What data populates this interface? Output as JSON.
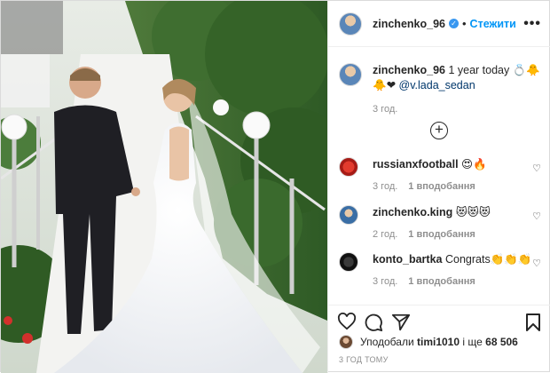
{
  "header": {
    "username": "zinchenko_96",
    "separator": "•",
    "follow_label": "Стежити",
    "more_icon": "more-horizontal-icon"
  },
  "caption": {
    "username": "zinchenko_96",
    "text": "1 year today 💍🐥",
    "text2": "🐥❤",
    "mention": "@v.lada_sedan",
    "time": "3 год."
  },
  "load_more_icon": "plus-circle-icon",
  "comments": [
    {
      "username": "russianxfootball",
      "text": "😍🔥",
      "time": "3 год.",
      "likes": "1 вподобання"
    },
    {
      "username": "zinchenko.king",
      "text": "😻😻😻",
      "time": "2 год.",
      "likes": "1 вподобання"
    },
    {
      "username": "konto_bartka",
      "text": "Congrats👏👏👏",
      "time": "3 год.",
      "likes": "1 вподобання"
    }
  ],
  "actions": {
    "like_icon": "heart-outline-icon",
    "comment_icon": "comment-icon",
    "share_icon": "paper-plane-icon",
    "save_icon": "bookmark-icon"
  },
  "likes": {
    "prefix": "Уподобали",
    "user": "timi1010",
    "middle": "і ще",
    "count": "68 506"
  },
  "post_time": "3 год тому",
  "colors": {
    "accent": "#0095f6",
    "text": "#262626",
    "muted": "#8e8e8e",
    "border": "#dbdbdb",
    "verified": "#3897f0"
  }
}
